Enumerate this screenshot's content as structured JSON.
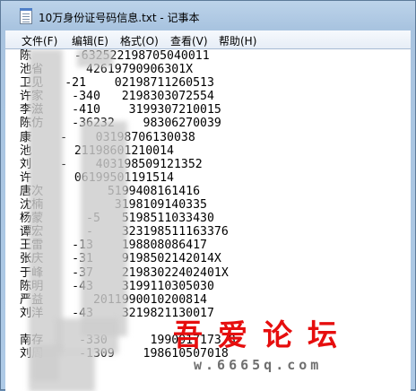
{
  "window": {
    "title": "10万身份证号码信息.txt - 记事本"
  },
  "menu": {
    "items": [
      {
        "label": "文件(F)"
      },
      {
        "label": "编辑(E)"
      },
      {
        "label": "格式(O)"
      },
      {
        "label": "查看(V)"
      },
      {
        "label": "帮助(H)"
      }
    ]
  },
  "document": {
    "lines": [
      "陈      -632522198705040011",
      "池省      42619790906301X",
      "卫见   -21    02198711260513",
      "许家    -340   2198303072554",
      "李滋    -410    3199307210015",
      "陈仿    -36232    98306270039",
      "康    -    03198706130038",
      "池      21198601210014",
      "刘    -    403198509121352",
      "许      06199501191514",
      "唐次         5199408161416",
      "沈楠          3198109140335",
      "杨蒙      -5   5198511033430",
      "谭宏      -    323198511163376",
      "王雷    -13    198808086417",
      "张庆    -31    9198502142014X",
      "于峰    -37    21983022402401X",
      "陈明    -43    3199110305030",
      "严益       2011990010200814",
      "刘洋    -43    3219821130017",
      "",
      "南存     -330      1990917173 8",
      "刘周     -1309    198610507018"
    ]
  },
  "watermark": {
    "text": "吾爱论坛",
    "url": "w.6665q.com"
  }
}
